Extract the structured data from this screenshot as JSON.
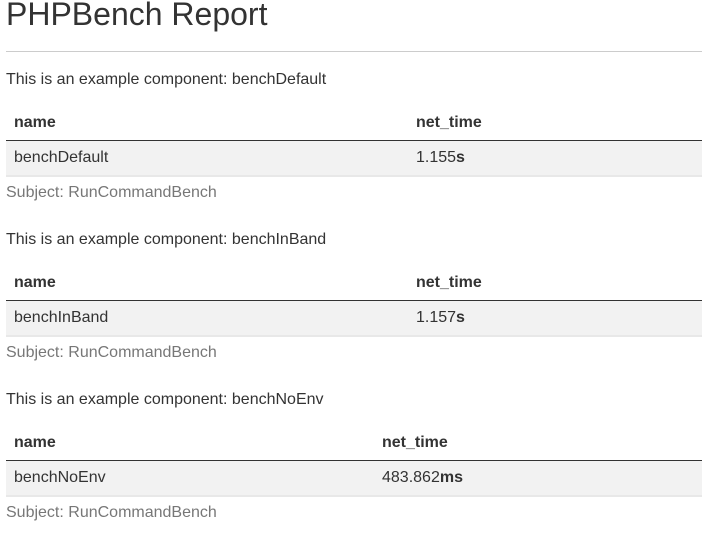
{
  "report_title": "PHPBench Report",
  "sections": [
    {
      "intro": "This is an example component: benchDefault",
      "columns": [
        "name",
        "net_time"
      ],
      "row": {
        "name": "benchDefault",
        "value": "1.155",
        "unit": "s"
      },
      "caption": "Subject: RunCommandBench"
    },
    {
      "intro": "This is an example component: benchInBand",
      "columns": [
        "name",
        "net_time"
      ],
      "row": {
        "name": "benchInBand",
        "value": "1.157",
        "unit": "s"
      },
      "caption": "Subject: RunCommandBench"
    },
    {
      "intro": "This is an example component: benchNoEnv",
      "columns": [
        "name",
        "net_time"
      ],
      "row": {
        "name": "benchNoEnv",
        "value": "483.862",
        "unit": "ms"
      },
      "caption": "Subject: RunCommandBench"
    }
  ]
}
